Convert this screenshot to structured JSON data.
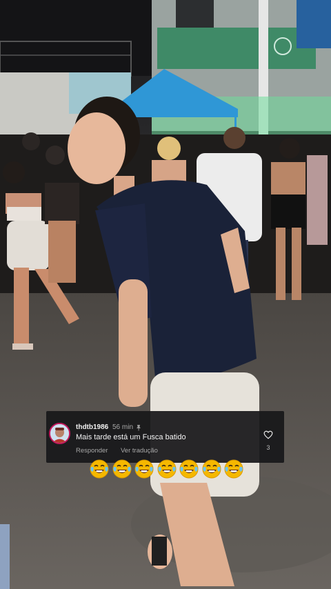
{
  "video": {
    "background": "dancing at a night street party"
  },
  "comment": {
    "username": "thdtb1986",
    "time": "56 min",
    "text": "Mais tarde está um Fusca batido",
    "reply_label": "Responder",
    "translate_label": "Ver tradução",
    "like_count": "3",
    "icons": {
      "pin": "pin-icon",
      "like": "heart-icon"
    }
  },
  "reaction": {
    "emoji": "face-with-tears-of-joy",
    "count": 7
  },
  "colors": {
    "comment_bg": "#18181a",
    "avatar_ring": "#c2185b",
    "emoji_yellow": "#f5b800"
  }
}
